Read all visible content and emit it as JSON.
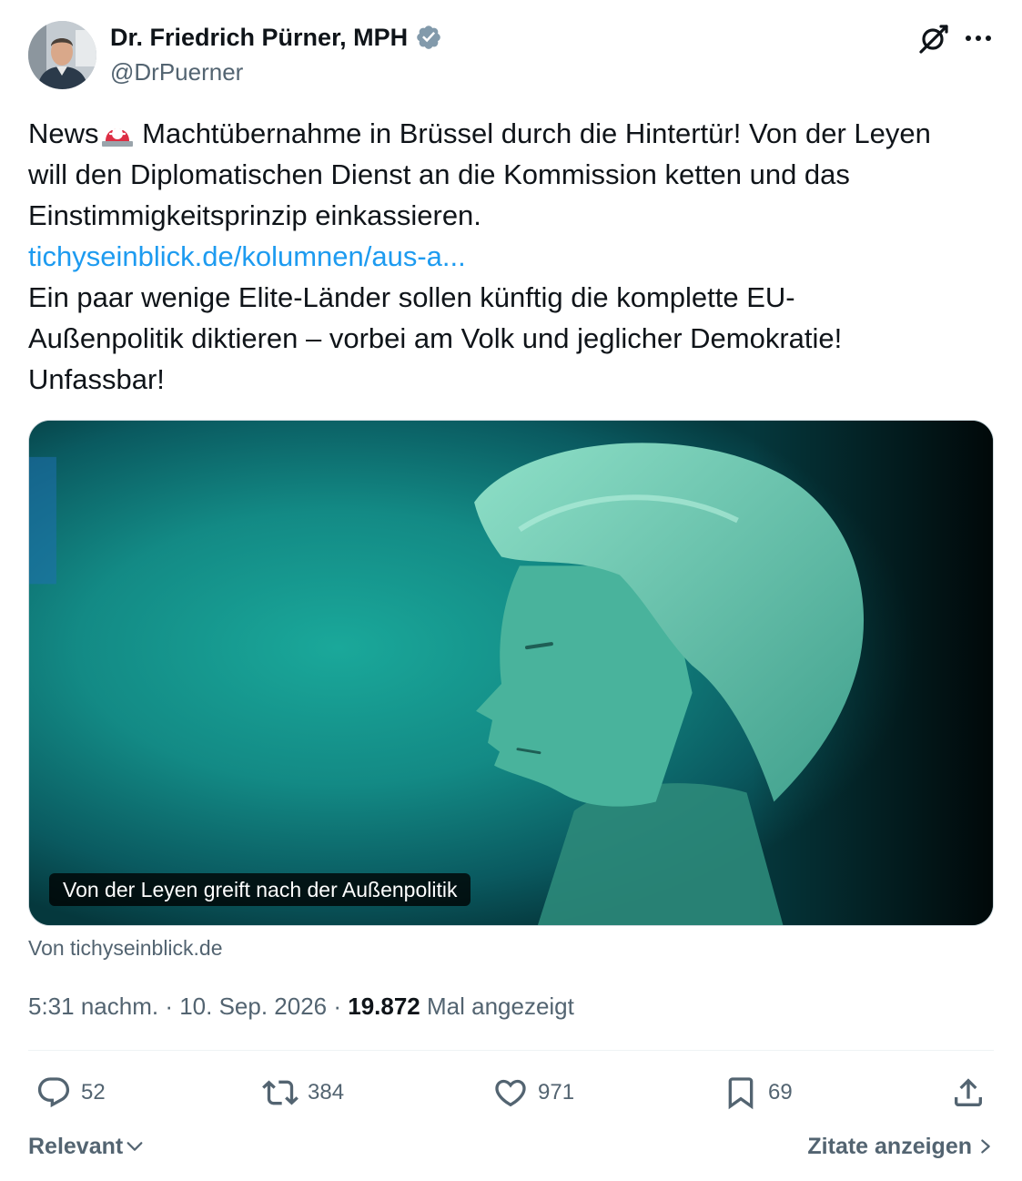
{
  "author": {
    "name": "Dr. Friedrich Pürner, MPH",
    "handle": "@DrPuerner",
    "verified_color": "#829aab"
  },
  "tweet": {
    "lines": [
      "News",
      " Machtübernahme in Brüssel durch die Hintertür! Von der Leyen",
      "will den Diplomatischen Dienst an die Kommission ketten und das",
      "Einstimmigkeitsprinzip einkassieren.",
      "tichyseinblick.de/kolumnen/aus-a...",
      "Ein paar wenige Elite-Länder sollen künftig die komplette EU-",
      "Außenpolitik diktieren – vorbei am Volk und jeglicher Demokratie!",
      "Unfassbar!"
    ],
    "emoji": "rotating-light-icon",
    "link_color": "#1d9bf0"
  },
  "card": {
    "caption": "Von der Leyen greift nach der Außenpolitik",
    "source": "Von tichyseinblick.de"
  },
  "meta": {
    "time": "5:31 nachm.",
    "sep1": " · ",
    "date": "10. Sep. 2026",
    "sep2": " · ",
    "views_count": "19.872",
    "views_label": " Mal angezeigt"
  },
  "actions": {
    "replies": "52",
    "reposts": "384",
    "likes": "971",
    "bookmarks": "69"
  },
  "footer": {
    "sort_label": "Relevant",
    "quotes_label": "Zitate anzeigen"
  },
  "colors": {
    "text": "#0f1419",
    "secondary": "#536471",
    "accent": "#1d9bf0"
  }
}
